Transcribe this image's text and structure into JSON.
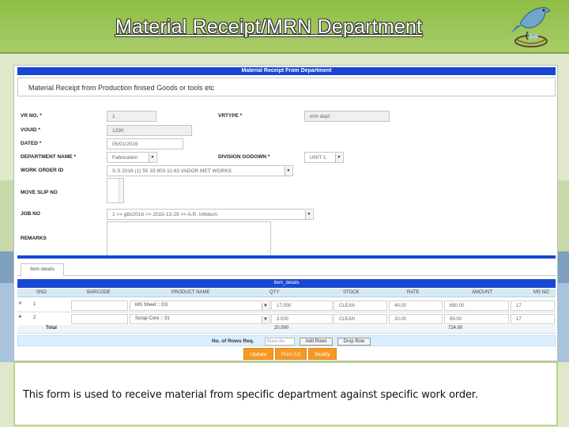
{
  "slide": {
    "title": "Material Receipt/MRN Department",
    "caption": "This form is used to receive material from specific department against specific work order."
  },
  "form": {
    "header": "Material Receipt From Department",
    "subtitle": "Material Receipt from Production finised Goods or tools etc",
    "labels": {
      "vr_no": "VR NO. *",
      "vrtype": "VRTYPE *",
      "voucher_id": "VOUID *",
      "dated": "DATED *",
      "department_name": "DEPARTMENT NAME *",
      "division_godown": "DIVISION GODOWN *",
      "work_order_id": "WORK ORDER ID",
      "move_slip_no": "MOVE SLIP NO",
      "job_no": "JOB NO",
      "remarks": "REMARKS"
    },
    "values": {
      "vr_no": "1",
      "vrtype": "mm dept",
      "voucher_id": "1290",
      "dated": "05/01/2016",
      "department_name": "Fabrication",
      "division_godown": "UNIT 1",
      "work_order_id": "S.S 2016 (1) 55 33 803 11:43 VADOR MET WORKS",
      "job_no": "1 >> gtb/2016 >> 2015-12-29 >> A.R. Infotech"
    }
  },
  "grid": {
    "tab_label": "Item details",
    "title": "Item_details",
    "columns": [
      "SNO",
      "BARCODE",
      "PRODUCT NAME",
      "QTY",
      "STOCK",
      "RATE",
      "AMOUNT",
      "MS NO"
    ],
    "rows": [
      {
        "sno": "1",
        "barcode": "",
        "product": "MS Sheet :: G3",
        "qty": "17.000",
        "stock": "CLEAN",
        "rate": "40.00",
        "amount": "680.00",
        "ms_no": "17"
      },
      {
        "sno": "2",
        "barcode": "",
        "product": "Scrap Core :: 31",
        "qty": "3.000",
        "stock": "CLEAN",
        "rate": "20.00",
        "amount": "69.00",
        "ms_no": "17"
      }
    ],
    "total_label": "Total",
    "total_qty": "20.000",
    "total_amount": "724.00",
    "rows_req_label": "No. of Rows Req.",
    "rows_req_placeholder": "Rows Re",
    "add_rows": "Add Rows",
    "drop_row": "Drop Row"
  },
  "actions": {
    "update": "Update",
    "print": "Print (U)",
    "modify": "Modify"
  },
  "colors": {
    "header_blue": "#1747d4",
    "action_orange": "#f39a23",
    "slide_green": "#9ec35a"
  }
}
